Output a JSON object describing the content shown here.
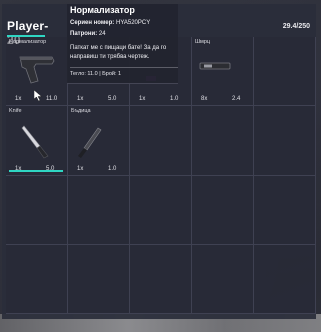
{
  "player": {
    "name": "Player-20"
  },
  "inventory": {
    "weight": "29.4/250"
  },
  "slots": [
    {
      "label": "Нормализатор",
      "qty": "1x",
      "weight": "11.0",
      "icon": "pistol-icon",
      "selected": true
    },
    {
      "label": "",
      "qty": "1x",
      "weight": "5.0",
      "icon": "",
      "selected": false
    },
    {
      "label": "",
      "qty": "1x",
      "weight": "1.0",
      "icon": "",
      "selected": false
    },
    {
      "label": "Шмрц",
      "qty": "8x",
      "weight": "2.4",
      "icon": "magazine-icon",
      "selected": false
    },
    {
      "label": "Knife",
      "qty": "1x",
      "weight": "5.0",
      "icon": "knife-icon",
      "selected": false
    },
    {
      "label": "Бъдица",
      "qty": "1x",
      "weight": "1.0",
      "icon": "dagger-icon",
      "selected": false
    }
  ],
  "tooltip": {
    "title": "Нормализатор",
    "serial_label": "Сериен номер:",
    "serial_value": "HYA520PCY",
    "ammo_label": "Патрони:",
    "ammo_value": "24",
    "description": "Паткат ме с пищаци бате! За да го направиш ти трябва чертеж.",
    "meta": "Тегло: 11.0 | Брой: 1"
  },
  "colors": {
    "accent": "#2fd6c3",
    "panel": "#2a2d3a"
  }
}
